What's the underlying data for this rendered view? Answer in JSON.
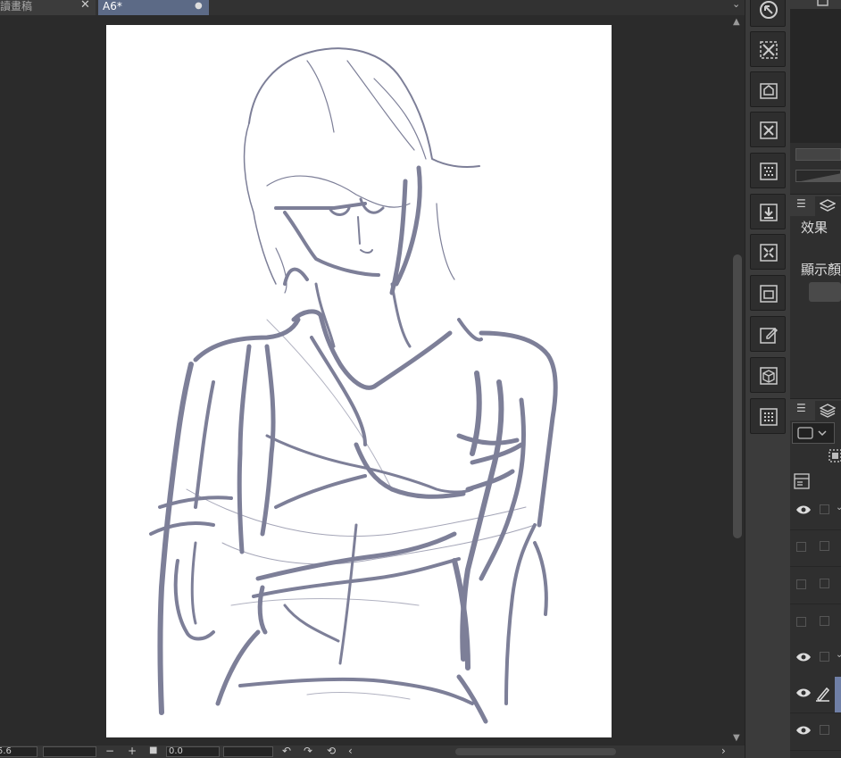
{
  "tabs": [
    {
      "label": "讀畫稿",
      "close_glyph": "✕"
    },
    {
      "label": "A6*",
      "modified_glyph": "●"
    }
  ],
  "tab_menu_glyph": "⌄",
  "bottom_bar": {
    "zoom_value": "5.6",
    "zoom_out_glyph": "−",
    "zoom_in_glyph": "+",
    "fit_glyph": "■",
    "rotation_value": "0.0",
    "undo_glyph": "↶",
    "redo_glyph": "↷",
    "reset_glyph": "⟲",
    "scroll_left_glyph": "‹",
    "scroll_right_glyph": "›"
  },
  "command_bar_icons": [
    "cursor-icon",
    "clear-selection-icon",
    "fill-icon",
    "close-layer-icon",
    "tone-icon",
    "import-icon",
    "transform-icon",
    "layer-icon",
    "edit-icon",
    "package-icon",
    "grid-icon"
  ],
  "panels": {
    "layer_property": {
      "menu_glyph": "☰",
      "effect_label": "效果",
      "display_color_label": "顯示顏"
    },
    "layer": {
      "menu_glyph": "☰"
    }
  },
  "layer_rows": [
    {
      "visible": true,
      "fold": "⌄"
    },
    {
      "visible": false
    },
    {
      "visible": false
    },
    {
      "visible": false
    },
    {
      "visible": true,
      "fold": "⌄"
    },
    {
      "visible": true,
      "pen": true,
      "selected": true
    },
    {
      "visible": true
    }
  ],
  "colors": {
    "sketch_stroke": "#7d7f98",
    "active_tab": "#5c6a86",
    "selected_layer": "#6f7fa6"
  }
}
